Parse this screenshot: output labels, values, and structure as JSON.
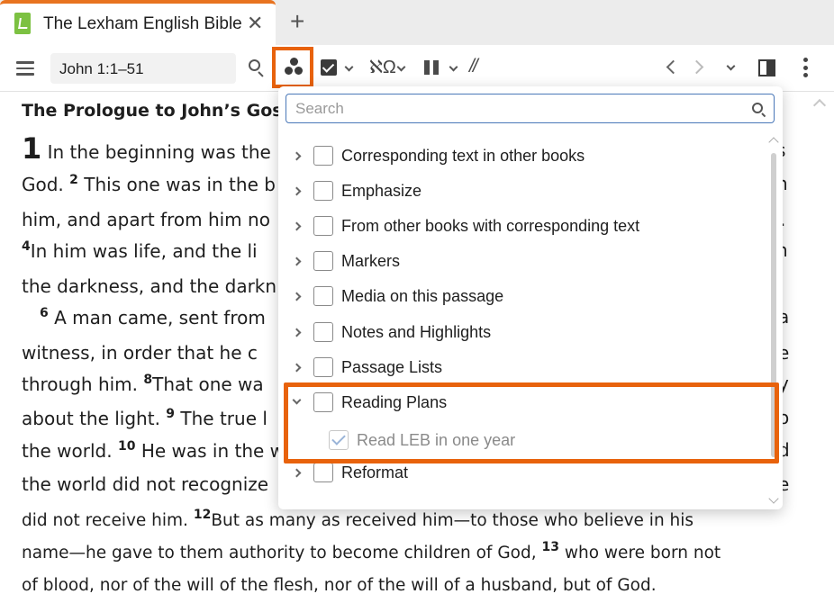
{
  "tab": {
    "title": "The Lexham English Bible",
    "close_glyph": "✕",
    "add_glyph": "+",
    "icon": "lexham-bible-icon"
  },
  "toolbar": {
    "reference": "John 1:1–51",
    "icons": [
      "menu-icon",
      "search-icon",
      "visual-filters-icon",
      "highlighting-icon",
      "interlinear-icon",
      "parallel-columns-icon",
      "text-divisions-icon",
      "back-icon",
      "forward-icon",
      "history-icon",
      "panel-layout-icon",
      "more-icon"
    ],
    "interlinear_glyph": "ℵΩ",
    "divisions_glyph": "//"
  },
  "text": {
    "heading": "The Prologue to John’s Gospe",
    "chapter": "1",
    "lines": {
      "l1": "In the beginning was the",
      "l1_end": "s",
      "l2": "God.",
      "v2": "2",
      "l2b": "This one was in the b",
      "l2_end": "n",
      "l3": "him, and apart from him no",
      "l3_end": ".",
      "v4": "4",
      "l4": "In him was life, and the li",
      "l4_end": "n",
      "l5": "the darkness, and the darkn",
      "v6": "6",
      "l6": "A man came, sent from",
      "l6_end": "a",
      "l7": "witness, in order that he c",
      "l7_end": "e",
      "l8": "through him.",
      "v8": "8",
      "l8b": "That one wa",
      "l8_end": "y",
      "l9": "about the light.",
      "v9": "9",
      "l9b": "The true l",
      "l9_end": "o",
      "l10": "the world.",
      "v10": "10",
      "l10b": "He was in the w",
      "l10_end": "d",
      "l11": "the world did not recognize",
      "l11_end": "e",
      "l12": "did not receive him.",
      "v12": "12",
      "l12b": "But as many as received him—to those who believe in his",
      "l13": "name—he gave to them authority to become children of God,",
      "v13": "13",
      "l13b": "who were born not",
      "l14": "of blood, nor of the will of the flesh, nor of the will of a husband, but of God."
    }
  },
  "panel": {
    "search_placeholder": "Search",
    "items": [
      {
        "label": "Corresponding text in other books",
        "checked": false
      },
      {
        "label": "Emphasize",
        "checked": false
      },
      {
        "label": "From other books with corresponding text",
        "checked": false
      },
      {
        "label": "Markers",
        "checked": false
      },
      {
        "label": "Media on this passage",
        "checked": false
      },
      {
        "label": "Notes and Highlights",
        "checked": false
      },
      {
        "label": "Passage Lists",
        "checked": false
      },
      {
        "label": "Reading Plans",
        "checked": false,
        "expanded": true
      },
      {
        "label": "Read LEB in one year",
        "checked": true,
        "disabled": true
      },
      {
        "label": "Reformat",
        "checked": false
      }
    ]
  },
  "colors": {
    "highlight": "#e8620c",
    "tab_accent": "#e8731f",
    "logo": "#7cc142",
    "search_border": "#4a78b8"
  }
}
